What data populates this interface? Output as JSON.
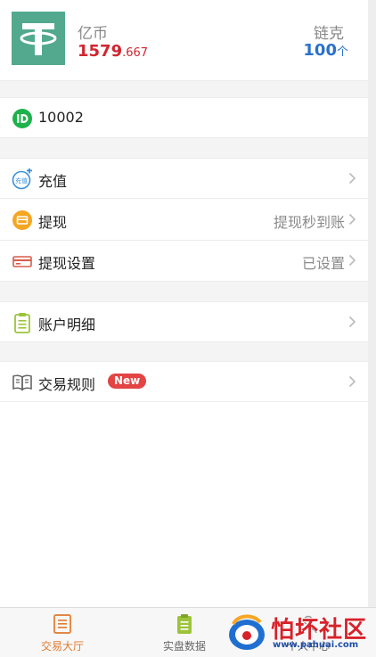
{
  "header": {
    "coin_name": "亿币",
    "balance_int": "1579",
    "balance_dec": ".667",
    "link_label": "链克",
    "link_value": "100",
    "link_unit": "个"
  },
  "user": {
    "id": "10002"
  },
  "menu": {
    "recharge": {
      "label": "充值",
      "icon_text": "充值"
    },
    "withdraw": {
      "label": "提现",
      "value": "提现秒到账"
    },
    "withdraw_settings": {
      "label": "提现设置",
      "value": "已设置"
    },
    "account_details": {
      "label": "账户明细"
    },
    "trade_rules": {
      "label": "交易规则",
      "badge": "New"
    }
  },
  "tabbar": {
    "tabs": [
      {
        "label": "交易大厅",
        "active": true
      },
      {
        "label": "实盘数据",
        "active": false
      },
      {
        "label": "个人中心",
        "active": false
      }
    ]
  },
  "watermark": {
    "title": "怕坏社区",
    "url": "www.pahuai.com"
  },
  "colors": {
    "balance_red": "#d02630",
    "link_blue": "#2a72c8",
    "tab_active": "#e07a2e",
    "id_green": "#1db24a",
    "withdraw_orange": "#f5a623",
    "badge_red": "#e34444"
  }
}
